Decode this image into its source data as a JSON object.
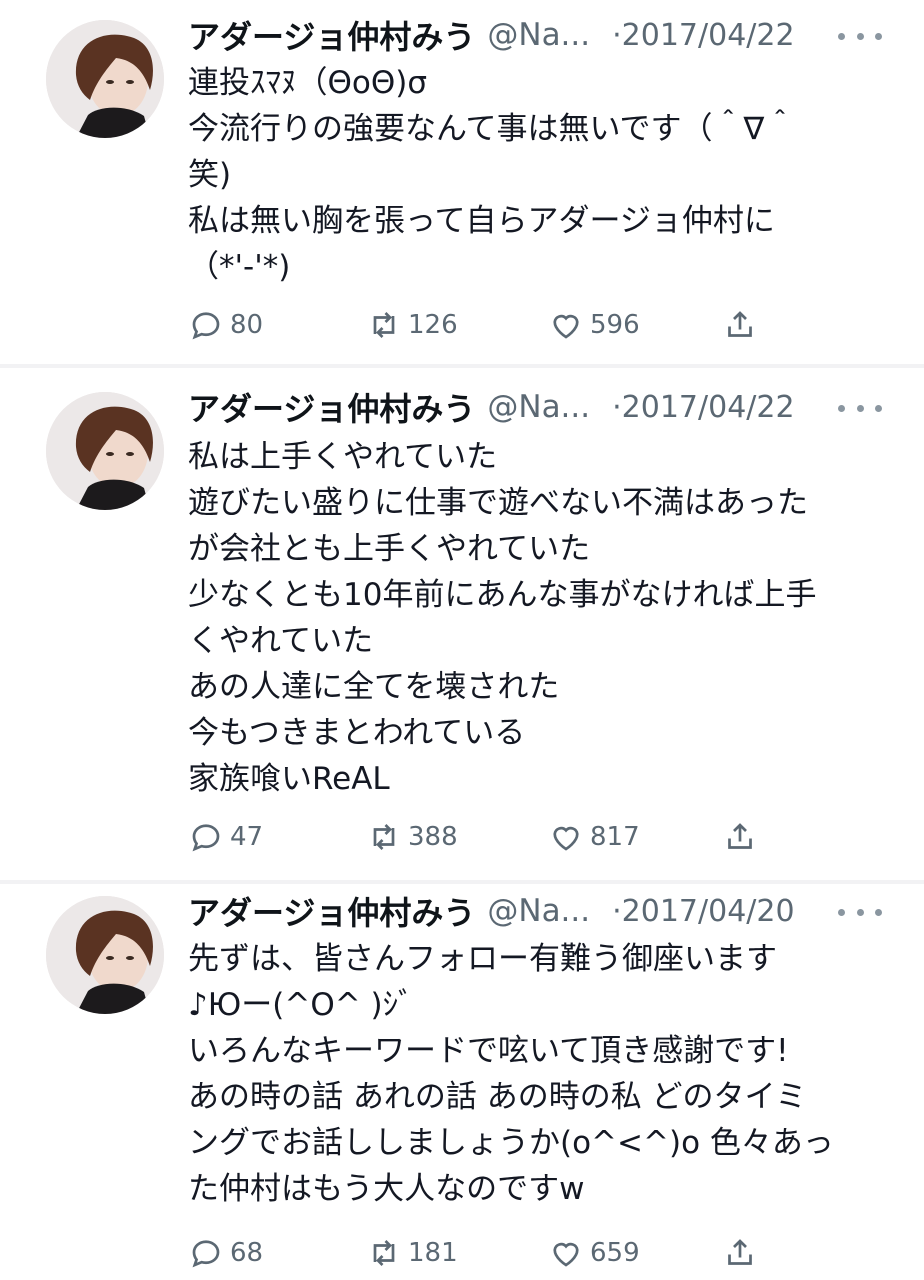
{
  "tweets": [
    {
      "name": "アダージョ仲村みう",
      "handle": "@Na...",
      "date": "·2017/04/22",
      "lines": [
        "連投ｽﾏﾇ（ΘoΘ)σ",
        "今流行りの強要なんて事は無いです（＾∇＾",
        "笑)",
        "私は無い胸を張って自らアダージョ仲村に",
        "（*'-'*)"
      ],
      "replies": "80",
      "retweets": "126",
      "likes": "596"
    },
    {
      "name": "アダージョ仲村みう",
      "handle": "@Na...",
      "date": "·2017/04/22",
      "lines": [
        "私は上手くやれていた",
        "遊びたい盛りに仕事で遊べない不満はあった",
        "が会社とも上手くやれていた",
        "少なくとも10年前にあんな事がなければ上手",
        "くやれていた",
        "あの人達に全てを壊された",
        "今もつきまとわれている",
        "家族喰いReAL"
      ],
      "replies": "47",
      "retweets": "388",
      "likes": "817"
    },
    {
      "name": "アダージョ仲村みう",
      "handle": "@Na...",
      "date": "·2017/04/20",
      "lines": [
        "先ずは、皆さんフォロー有難う御座います",
        "♪Юー(^O^ )ｼﾞ",
        "いろんなキーワードで呟いて頂き感謝です!",
        "あの時の話 あれの話 あの時の私 どのタイミ",
        "ングでお話ししましょうか(o^<^)o 色々あっ",
        "た仲村はもう大人なのですw"
      ],
      "replies": "68",
      "retweets": "181",
      "likes": "659"
    }
  ],
  "icons": {
    "reply": "speech-bubble",
    "retweet": "retweet-arrows",
    "like": "heart",
    "share": "share-upload",
    "more": "ellipsis"
  },
  "colors": {
    "text": "#141823",
    "muted": "#5b6873",
    "separator": "#f2f2f4"
  }
}
